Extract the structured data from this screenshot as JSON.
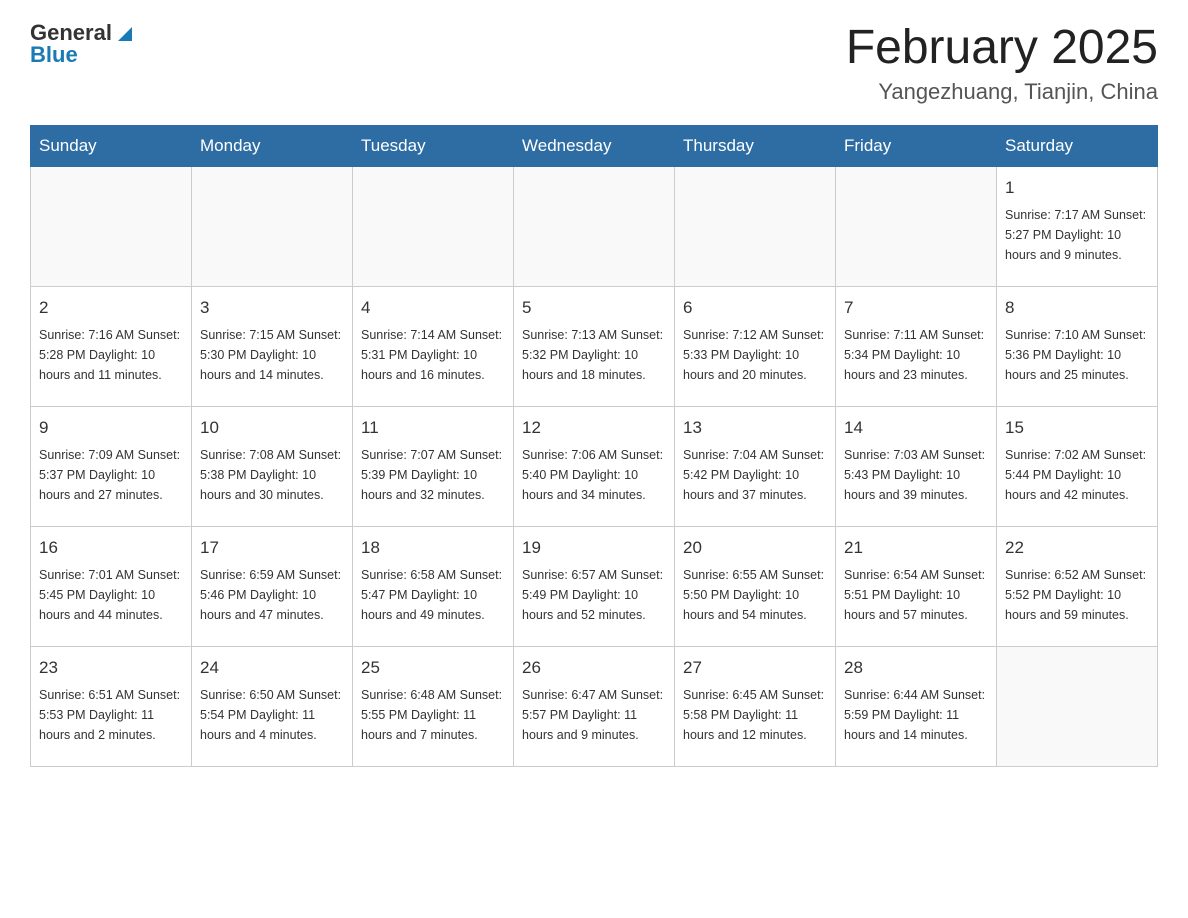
{
  "header": {
    "logo": {
      "general": "General",
      "blue": "Blue"
    },
    "title": "February 2025",
    "location": "Yangezhuang, Tianjin, China"
  },
  "weekdays": [
    "Sunday",
    "Monday",
    "Tuesday",
    "Wednesday",
    "Thursday",
    "Friday",
    "Saturday"
  ],
  "weeks": [
    [
      {
        "day": "",
        "info": ""
      },
      {
        "day": "",
        "info": ""
      },
      {
        "day": "",
        "info": ""
      },
      {
        "day": "",
        "info": ""
      },
      {
        "day": "",
        "info": ""
      },
      {
        "day": "",
        "info": ""
      },
      {
        "day": "1",
        "info": "Sunrise: 7:17 AM\nSunset: 5:27 PM\nDaylight: 10 hours and 9 minutes."
      }
    ],
    [
      {
        "day": "2",
        "info": "Sunrise: 7:16 AM\nSunset: 5:28 PM\nDaylight: 10 hours and 11 minutes."
      },
      {
        "day": "3",
        "info": "Sunrise: 7:15 AM\nSunset: 5:30 PM\nDaylight: 10 hours and 14 minutes."
      },
      {
        "day": "4",
        "info": "Sunrise: 7:14 AM\nSunset: 5:31 PM\nDaylight: 10 hours and 16 minutes."
      },
      {
        "day": "5",
        "info": "Sunrise: 7:13 AM\nSunset: 5:32 PM\nDaylight: 10 hours and 18 minutes."
      },
      {
        "day": "6",
        "info": "Sunrise: 7:12 AM\nSunset: 5:33 PM\nDaylight: 10 hours and 20 minutes."
      },
      {
        "day": "7",
        "info": "Sunrise: 7:11 AM\nSunset: 5:34 PM\nDaylight: 10 hours and 23 minutes."
      },
      {
        "day": "8",
        "info": "Sunrise: 7:10 AM\nSunset: 5:36 PM\nDaylight: 10 hours and 25 minutes."
      }
    ],
    [
      {
        "day": "9",
        "info": "Sunrise: 7:09 AM\nSunset: 5:37 PM\nDaylight: 10 hours and 27 minutes."
      },
      {
        "day": "10",
        "info": "Sunrise: 7:08 AM\nSunset: 5:38 PM\nDaylight: 10 hours and 30 minutes."
      },
      {
        "day": "11",
        "info": "Sunrise: 7:07 AM\nSunset: 5:39 PM\nDaylight: 10 hours and 32 minutes."
      },
      {
        "day": "12",
        "info": "Sunrise: 7:06 AM\nSunset: 5:40 PM\nDaylight: 10 hours and 34 minutes."
      },
      {
        "day": "13",
        "info": "Sunrise: 7:04 AM\nSunset: 5:42 PM\nDaylight: 10 hours and 37 minutes."
      },
      {
        "day": "14",
        "info": "Sunrise: 7:03 AM\nSunset: 5:43 PM\nDaylight: 10 hours and 39 minutes."
      },
      {
        "day": "15",
        "info": "Sunrise: 7:02 AM\nSunset: 5:44 PM\nDaylight: 10 hours and 42 minutes."
      }
    ],
    [
      {
        "day": "16",
        "info": "Sunrise: 7:01 AM\nSunset: 5:45 PM\nDaylight: 10 hours and 44 minutes."
      },
      {
        "day": "17",
        "info": "Sunrise: 6:59 AM\nSunset: 5:46 PM\nDaylight: 10 hours and 47 minutes."
      },
      {
        "day": "18",
        "info": "Sunrise: 6:58 AM\nSunset: 5:47 PM\nDaylight: 10 hours and 49 minutes."
      },
      {
        "day": "19",
        "info": "Sunrise: 6:57 AM\nSunset: 5:49 PM\nDaylight: 10 hours and 52 minutes."
      },
      {
        "day": "20",
        "info": "Sunrise: 6:55 AM\nSunset: 5:50 PM\nDaylight: 10 hours and 54 minutes."
      },
      {
        "day": "21",
        "info": "Sunrise: 6:54 AM\nSunset: 5:51 PM\nDaylight: 10 hours and 57 minutes."
      },
      {
        "day": "22",
        "info": "Sunrise: 6:52 AM\nSunset: 5:52 PM\nDaylight: 10 hours and 59 minutes."
      }
    ],
    [
      {
        "day": "23",
        "info": "Sunrise: 6:51 AM\nSunset: 5:53 PM\nDaylight: 11 hours and 2 minutes."
      },
      {
        "day": "24",
        "info": "Sunrise: 6:50 AM\nSunset: 5:54 PM\nDaylight: 11 hours and 4 minutes."
      },
      {
        "day": "25",
        "info": "Sunrise: 6:48 AM\nSunset: 5:55 PM\nDaylight: 11 hours and 7 minutes."
      },
      {
        "day": "26",
        "info": "Sunrise: 6:47 AM\nSunset: 5:57 PM\nDaylight: 11 hours and 9 minutes."
      },
      {
        "day": "27",
        "info": "Sunrise: 6:45 AM\nSunset: 5:58 PM\nDaylight: 11 hours and 12 minutes."
      },
      {
        "day": "28",
        "info": "Sunrise: 6:44 AM\nSunset: 5:59 PM\nDaylight: 11 hours and 14 minutes."
      },
      {
        "day": "",
        "info": ""
      }
    ]
  ]
}
